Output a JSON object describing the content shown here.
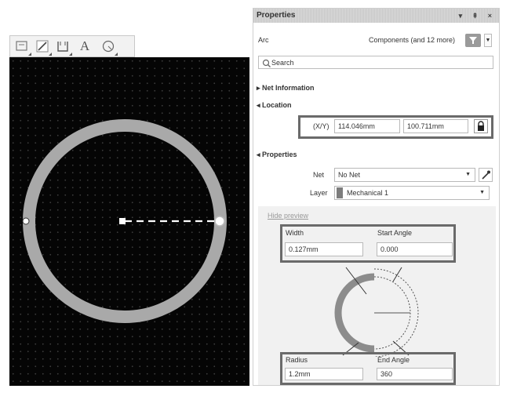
{
  "toolbar": {
    "tools": [
      "line-tool-icon",
      "pen-tool-icon",
      "bin-tool-icon",
      "text-tool-icon",
      "arc-tool-icon"
    ],
    "text_tool_glyph": "A"
  },
  "panel": {
    "title": "Properties",
    "title_controls": "▾ ⇞ ×",
    "object_type": "Arc",
    "filter_summary": "Components (and 12 more)",
    "search_placeholder": "Search",
    "sections": {
      "net_information": "Net Information",
      "location": "Location",
      "properties": "Properties"
    },
    "location": {
      "xy_label": "(X/Y)",
      "x": "114.046mm",
      "y": "100.711mm"
    },
    "props": {
      "net_label": "Net",
      "net_value": "No Net",
      "layer_label": "Layer",
      "layer_value": "Mechanical 1"
    },
    "preview": {
      "hide_link": "Hide preview",
      "width_label": "Width",
      "width_value": "0.127mm",
      "start_angle_label": "Start Angle",
      "start_angle_value": "0.000",
      "radius_label": "Radius",
      "radius_value": "1.2mm",
      "end_angle_label": "End Angle",
      "end_angle_value": "360"
    }
  },
  "colors": {
    "canvas_bg": "#050505",
    "arc_ring": "#a9a9a9",
    "highlight_box": "#6a6a6a",
    "filter_button": "#9a9a9a",
    "layer_swatch": "#7d7d7d"
  }
}
